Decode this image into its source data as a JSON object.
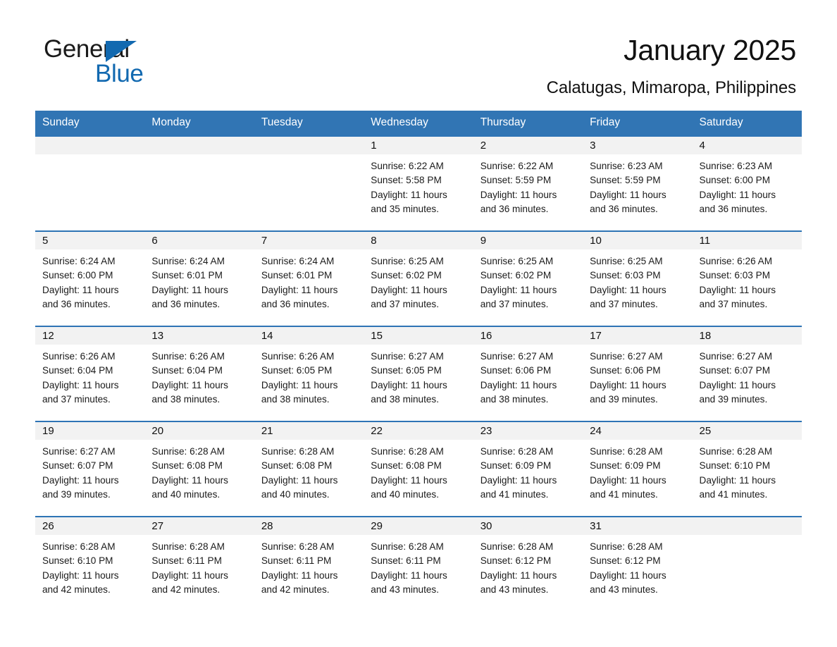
{
  "brand": {
    "name_part1": "General",
    "name_part2": "Blue",
    "triangle_color": "#1269b0"
  },
  "header": {
    "title": "January 2025",
    "subtitle": "Calatugas, Mimaropa, Philippines"
  },
  "theme": {
    "header_bg": "#3175b4",
    "row_divider": "#2e74b5",
    "daynum_band_bg": "#f2f2f2",
    "page_bg": "#ffffff"
  },
  "calendar": {
    "weekday_headers": [
      "Sunday",
      "Monday",
      "Tuesday",
      "Wednesday",
      "Thursday",
      "Friday",
      "Saturday"
    ],
    "weeks": [
      [
        {
          "day": "",
          "sunrise": "",
          "sunset": "",
          "daylight_line1": "",
          "daylight_line2": ""
        },
        {
          "day": "",
          "sunrise": "",
          "sunset": "",
          "daylight_line1": "",
          "daylight_line2": ""
        },
        {
          "day": "",
          "sunrise": "",
          "sunset": "",
          "daylight_line1": "",
          "daylight_line2": ""
        },
        {
          "day": "1",
          "sunrise": "Sunrise: 6:22 AM",
          "sunset": "Sunset: 5:58 PM",
          "daylight_line1": "Daylight: 11 hours",
          "daylight_line2": "and 35 minutes."
        },
        {
          "day": "2",
          "sunrise": "Sunrise: 6:22 AM",
          "sunset": "Sunset: 5:59 PM",
          "daylight_line1": "Daylight: 11 hours",
          "daylight_line2": "and 36 minutes."
        },
        {
          "day": "3",
          "sunrise": "Sunrise: 6:23 AM",
          "sunset": "Sunset: 5:59 PM",
          "daylight_line1": "Daylight: 11 hours",
          "daylight_line2": "and 36 minutes."
        },
        {
          "day": "4",
          "sunrise": "Sunrise: 6:23 AM",
          "sunset": "Sunset: 6:00 PM",
          "daylight_line1": "Daylight: 11 hours",
          "daylight_line2": "and 36 minutes."
        }
      ],
      [
        {
          "day": "5",
          "sunrise": "Sunrise: 6:24 AM",
          "sunset": "Sunset: 6:00 PM",
          "daylight_line1": "Daylight: 11 hours",
          "daylight_line2": "and 36 minutes."
        },
        {
          "day": "6",
          "sunrise": "Sunrise: 6:24 AM",
          "sunset": "Sunset: 6:01 PM",
          "daylight_line1": "Daylight: 11 hours",
          "daylight_line2": "and 36 minutes."
        },
        {
          "day": "7",
          "sunrise": "Sunrise: 6:24 AM",
          "sunset": "Sunset: 6:01 PM",
          "daylight_line1": "Daylight: 11 hours",
          "daylight_line2": "and 36 minutes."
        },
        {
          "day": "8",
          "sunrise": "Sunrise: 6:25 AM",
          "sunset": "Sunset: 6:02 PM",
          "daylight_line1": "Daylight: 11 hours",
          "daylight_line2": "and 37 minutes."
        },
        {
          "day": "9",
          "sunrise": "Sunrise: 6:25 AM",
          "sunset": "Sunset: 6:02 PM",
          "daylight_line1": "Daylight: 11 hours",
          "daylight_line2": "and 37 minutes."
        },
        {
          "day": "10",
          "sunrise": "Sunrise: 6:25 AM",
          "sunset": "Sunset: 6:03 PM",
          "daylight_line1": "Daylight: 11 hours",
          "daylight_line2": "and 37 minutes."
        },
        {
          "day": "11",
          "sunrise": "Sunrise: 6:26 AM",
          "sunset": "Sunset: 6:03 PM",
          "daylight_line1": "Daylight: 11 hours",
          "daylight_line2": "and 37 minutes."
        }
      ],
      [
        {
          "day": "12",
          "sunrise": "Sunrise: 6:26 AM",
          "sunset": "Sunset: 6:04 PM",
          "daylight_line1": "Daylight: 11 hours",
          "daylight_line2": "and 37 minutes."
        },
        {
          "day": "13",
          "sunrise": "Sunrise: 6:26 AM",
          "sunset": "Sunset: 6:04 PM",
          "daylight_line1": "Daylight: 11 hours",
          "daylight_line2": "and 38 minutes."
        },
        {
          "day": "14",
          "sunrise": "Sunrise: 6:26 AM",
          "sunset": "Sunset: 6:05 PM",
          "daylight_line1": "Daylight: 11 hours",
          "daylight_line2": "and 38 minutes."
        },
        {
          "day": "15",
          "sunrise": "Sunrise: 6:27 AM",
          "sunset": "Sunset: 6:05 PM",
          "daylight_line1": "Daylight: 11 hours",
          "daylight_line2": "and 38 minutes."
        },
        {
          "day": "16",
          "sunrise": "Sunrise: 6:27 AM",
          "sunset": "Sunset: 6:06 PM",
          "daylight_line1": "Daylight: 11 hours",
          "daylight_line2": "and 38 minutes."
        },
        {
          "day": "17",
          "sunrise": "Sunrise: 6:27 AM",
          "sunset": "Sunset: 6:06 PM",
          "daylight_line1": "Daylight: 11 hours",
          "daylight_line2": "and 39 minutes."
        },
        {
          "day": "18",
          "sunrise": "Sunrise: 6:27 AM",
          "sunset": "Sunset: 6:07 PM",
          "daylight_line1": "Daylight: 11 hours",
          "daylight_line2": "and 39 minutes."
        }
      ],
      [
        {
          "day": "19",
          "sunrise": "Sunrise: 6:27 AM",
          "sunset": "Sunset: 6:07 PM",
          "daylight_line1": "Daylight: 11 hours",
          "daylight_line2": "and 39 minutes."
        },
        {
          "day": "20",
          "sunrise": "Sunrise: 6:28 AM",
          "sunset": "Sunset: 6:08 PM",
          "daylight_line1": "Daylight: 11 hours",
          "daylight_line2": "and 40 minutes."
        },
        {
          "day": "21",
          "sunrise": "Sunrise: 6:28 AM",
          "sunset": "Sunset: 6:08 PM",
          "daylight_line1": "Daylight: 11 hours",
          "daylight_line2": "and 40 minutes."
        },
        {
          "day": "22",
          "sunrise": "Sunrise: 6:28 AM",
          "sunset": "Sunset: 6:08 PM",
          "daylight_line1": "Daylight: 11 hours",
          "daylight_line2": "and 40 minutes."
        },
        {
          "day": "23",
          "sunrise": "Sunrise: 6:28 AM",
          "sunset": "Sunset: 6:09 PM",
          "daylight_line1": "Daylight: 11 hours",
          "daylight_line2": "and 41 minutes."
        },
        {
          "day": "24",
          "sunrise": "Sunrise: 6:28 AM",
          "sunset": "Sunset: 6:09 PM",
          "daylight_line1": "Daylight: 11 hours",
          "daylight_line2": "and 41 minutes."
        },
        {
          "day": "25",
          "sunrise": "Sunrise: 6:28 AM",
          "sunset": "Sunset: 6:10 PM",
          "daylight_line1": "Daylight: 11 hours",
          "daylight_line2": "and 41 minutes."
        }
      ],
      [
        {
          "day": "26",
          "sunrise": "Sunrise: 6:28 AM",
          "sunset": "Sunset: 6:10 PM",
          "daylight_line1": "Daylight: 11 hours",
          "daylight_line2": "and 42 minutes."
        },
        {
          "day": "27",
          "sunrise": "Sunrise: 6:28 AM",
          "sunset": "Sunset: 6:11 PM",
          "daylight_line1": "Daylight: 11 hours",
          "daylight_line2": "and 42 minutes."
        },
        {
          "day": "28",
          "sunrise": "Sunrise: 6:28 AM",
          "sunset": "Sunset: 6:11 PM",
          "daylight_line1": "Daylight: 11 hours",
          "daylight_line2": "and 42 minutes."
        },
        {
          "day": "29",
          "sunrise": "Sunrise: 6:28 AM",
          "sunset": "Sunset: 6:11 PM",
          "daylight_line1": "Daylight: 11 hours",
          "daylight_line2": "and 43 minutes."
        },
        {
          "day": "30",
          "sunrise": "Sunrise: 6:28 AM",
          "sunset": "Sunset: 6:12 PM",
          "daylight_line1": "Daylight: 11 hours",
          "daylight_line2": "and 43 minutes."
        },
        {
          "day": "31",
          "sunrise": "Sunrise: 6:28 AM",
          "sunset": "Sunset: 6:12 PM",
          "daylight_line1": "Daylight: 11 hours",
          "daylight_line2": "and 43 minutes."
        },
        {
          "day": "",
          "sunrise": "",
          "sunset": "",
          "daylight_line1": "",
          "daylight_line2": ""
        }
      ]
    ]
  }
}
